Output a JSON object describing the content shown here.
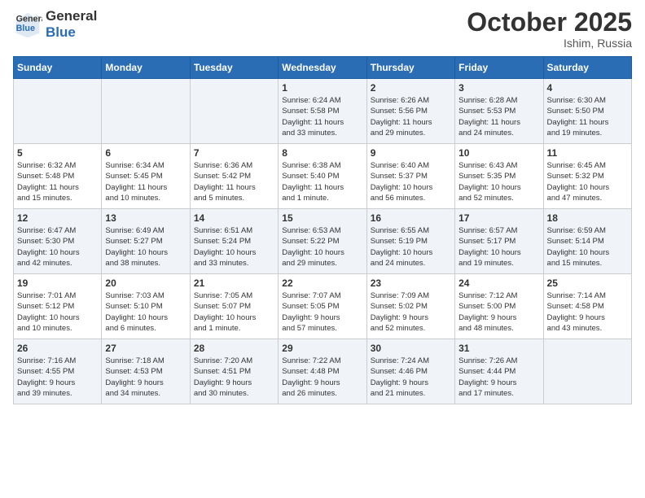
{
  "logo": {
    "line1": "General",
    "line2": "Blue"
  },
  "title": "October 2025",
  "subtitle": "Ishim, Russia",
  "days_of_week": [
    "Sunday",
    "Monday",
    "Tuesday",
    "Wednesday",
    "Thursday",
    "Friday",
    "Saturday"
  ],
  "weeks": [
    [
      {
        "day": "",
        "info": ""
      },
      {
        "day": "",
        "info": ""
      },
      {
        "day": "",
        "info": ""
      },
      {
        "day": "1",
        "info": "Sunrise: 6:24 AM\nSunset: 5:58 PM\nDaylight: 11 hours\nand 33 minutes."
      },
      {
        "day": "2",
        "info": "Sunrise: 6:26 AM\nSunset: 5:56 PM\nDaylight: 11 hours\nand 29 minutes."
      },
      {
        "day": "3",
        "info": "Sunrise: 6:28 AM\nSunset: 5:53 PM\nDaylight: 11 hours\nand 24 minutes."
      },
      {
        "day": "4",
        "info": "Sunrise: 6:30 AM\nSunset: 5:50 PM\nDaylight: 11 hours\nand 19 minutes."
      }
    ],
    [
      {
        "day": "5",
        "info": "Sunrise: 6:32 AM\nSunset: 5:48 PM\nDaylight: 11 hours\nand 15 minutes."
      },
      {
        "day": "6",
        "info": "Sunrise: 6:34 AM\nSunset: 5:45 PM\nDaylight: 11 hours\nand 10 minutes."
      },
      {
        "day": "7",
        "info": "Sunrise: 6:36 AM\nSunset: 5:42 PM\nDaylight: 11 hours\nand 5 minutes."
      },
      {
        "day": "8",
        "info": "Sunrise: 6:38 AM\nSunset: 5:40 PM\nDaylight: 11 hours\nand 1 minute."
      },
      {
        "day": "9",
        "info": "Sunrise: 6:40 AM\nSunset: 5:37 PM\nDaylight: 10 hours\nand 56 minutes."
      },
      {
        "day": "10",
        "info": "Sunrise: 6:43 AM\nSunset: 5:35 PM\nDaylight: 10 hours\nand 52 minutes."
      },
      {
        "day": "11",
        "info": "Sunrise: 6:45 AM\nSunset: 5:32 PM\nDaylight: 10 hours\nand 47 minutes."
      }
    ],
    [
      {
        "day": "12",
        "info": "Sunrise: 6:47 AM\nSunset: 5:30 PM\nDaylight: 10 hours\nand 42 minutes."
      },
      {
        "day": "13",
        "info": "Sunrise: 6:49 AM\nSunset: 5:27 PM\nDaylight: 10 hours\nand 38 minutes."
      },
      {
        "day": "14",
        "info": "Sunrise: 6:51 AM\nSunset: 5:24 PM\nDaylight: 10 hours\nand 33 minutes."
      },
      {
        "day": "15",
        "info": "Sunrise: 6:53 AM\nSunset: 5:22 PM\nDaylight: 10 hours\nand 29 minutes."
      },
      {
        "day": "16",
        "info": "Sunrise: 6:55 AM\nSunset: 5:19 PM\nDaylight: 10 hours\nand 24 minutes."
      },
      {
        "day": "17",
        "info": "Sunrise: 6:57 AM\nSunset: 5:17 PM\nDaylight: 10 hours\nand 19 minutes."
      },
      {
        "day": "18",
        "info": "Sunrise: 6:59 AM\nSunset: 5:14 PM\nDaylight: 10 hours\nand 15 minutes."
      }
    ],
    [
      {
        "day": "19",
        "info": "Sunrise: 7:01 AM\nSunset: 5:12 PM\nDaylight: 10 hours\nand 10 minutes."
      },
      {
        "day": "20",
        "info": "Sunrise: 7:03 AM\nSunset: 5:10 PM\nDaylight: 10 hours\nand 6 minutes."
      },
      {
        "day": "21",
        "info": "Sunrise: 7:05 AM\nSunset: 5:07 PM\nDaylight: 10 hours\nand 1 minute."
      },
      {
        "day": "22",
        "info": "Sunrise: 7:07 AM\nSunset: 5:05 PM\nDaylight: 9 hours\nand 57 minutes."
      },
      {
        "day": "23",
        "info": "Sunrise: 7:09 AM\nSunset: 5:02 PM\nDaylight: 9 hours\nand 52 minutes."
      },
      {
        "day": "24",
        "info": "Sunrise: 7:12 AM\nSunset: 5:00 PM\nDaylight: 9 hours\nand 48 minutes."
      },
      {
        "day": "25",
        "info": "Sunrise: 7:14 AM\nSunset: 4:58 PM\nDaylight: 9 hours\nand 43 minutes."
      }
    ],
    [
      {
        "day": "26",
        "info": "Sunrise: 7:16 AM\nSunset: 4:55 PM\nDaylight: 9 hours\nand 39 minutes."
      },
      {
        "day": "27",
        "info": "Sunrise: 7:18 AM\nSunset: 4:53 PM\nDaylight: 9 hours\nand 34 minutes."
      },
      {
        "day": "28",
        "info": "Sunrise: 7:20 AM\nSunset: 4:51 PM\nDaylight: 9 hours\nand 30 minutes."
      },
      {
        "day": "29",
        "info": "Sunrise: 7:22 AM\nSunset: 4:48 PM\nDaylight: 9 hours\nand 26 minutes."
      },
      {
        "day": "30",
        "info": "Sunrise: 7:24 AM\nSunset: 4:46 PM\nDaylight: 9 hours\nand 21 minutes."
      },
      {
        "day": "31",
        "info": "Sunrise: 7:26 AM\nSunset: 4:44 PM\nDaylight: 9 hours\nand 17 minutes."
      },
      {
        "day": "",
        "info": ""
      }
    ]
  ]
}
